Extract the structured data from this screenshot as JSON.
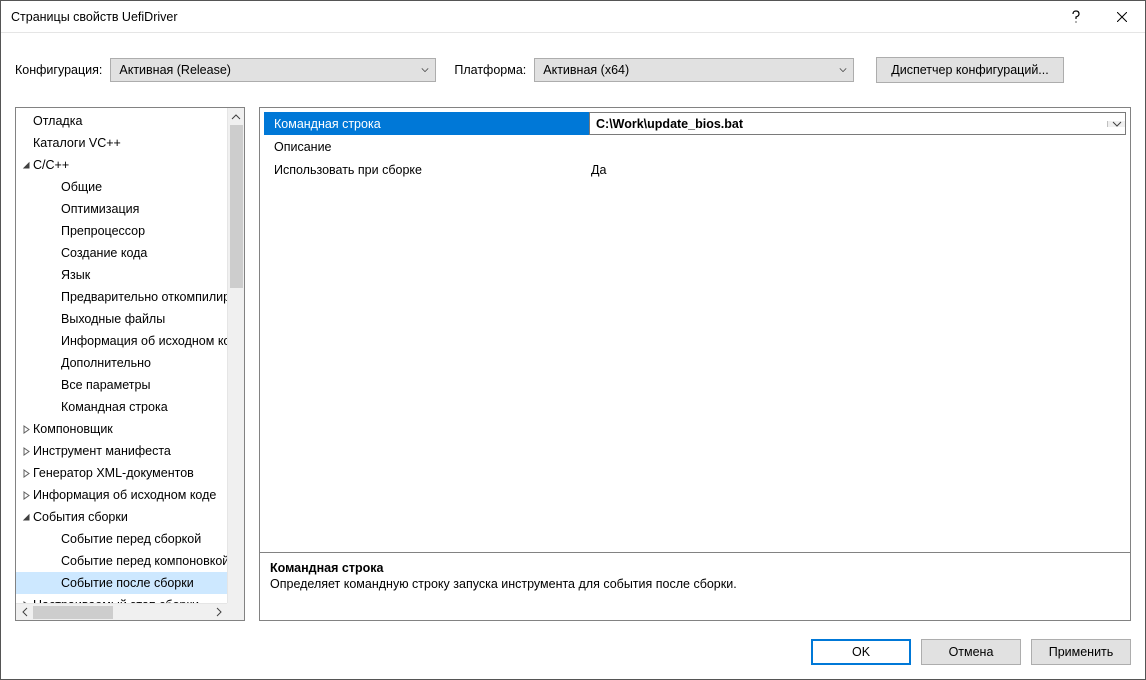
{
  "window": {
    "title": "Страницы свойств UefiDriver"
  },
  "config": {
    "label": "Конфигурация:",
    "value": "Активная (Release)"
  },
  "platform": {
    "label": "Платформа:",
    "value": "Активная (x64)"
  },
  "config_manager": "Диспетчер конфигураций...",
  "tree": {
    "items": [
      {
        "level": 1,
        "label": "Отладка",
        "expand": "none"
      },
      {
        "level": 1,
        "label": "Каталоги VC++",
        "expand": "none"
      },
      {
        "level": 1,
        "label": "C/C++",
        "expand": "open"
      },
      {
        "level": 2,
        "label": "Общие",
        "expand": "none"
      },
      {
        "level": 2,
        "label": "Оптимизация",
        "expand": "none"
      },
      {
        "level": 2,
        "label": "Препроцессор",
        "expand": "none"
      },
      {
        "level": 2,
        "label": "Создание кода",
        "expand": "none"
      },
      {
        "level": 2,
        "label": "Язык",
        "expand": "none"
      },
      {
        "level": 2,
        "label": "Предварительно откомпилированные заголовки",
        "expand": "none"
      },
      {
        "level": 2,
        "label": "Выходные файлы",
        "expand": "none"
      },
      {
        "level": 2,
        "label": "Информация об исходном коде",
        "expand": "none"
      },
      {
        "level": 2,
        "label": "Дополнительно",
        "expand": "none"
      },
      {
        "level": 2,
        "label": "Все параметры",
        "expand": "none"
      },
      {
        "level": 2,
        "label": "Командная строка",
        "expand": "none"
      },
      {
        "level": 1,
        "label": "Компоновщик",
        "expand": "closed"
      },
      {
        "level": 1,
        "label": "Инструмент манифеста",
        "expand": "closed"
      },
      {
        "level": 1,
        "label": "Генератор XML-документов",
        "expand": "closed"
      },
      {
        "level": 1,
        "label": "Информация об исходном коде",
        "expand": "closed"
      },
      {
        "level": 1,
        "label": "События сборки",
        "expand": "open"
      },
      {
        "level": 2,
        "label": "Событие перед сборкой",
        "expand": "none"
      },
      {
        "level": 2,
        "label": "Событие перед компоновкой",
        "expand": "none"
      },
      {
        "level": 2,
        "label": "Событие после сборки",
        "expand": "none",
        "selected": true
      },
      {
        "level": 1,
        "label": "Настраиваемый этап сборки",
        "expand": "closed"
      }
    ]
  },
  "grid": {
    "rows": [
      {
        "key": "Командная строка",
        "value": "C:\\Work\\update_bios.bat",
        "selected": true
      },
      {
        "key": "Описание",
        "value": ""
      },
      {
        "key": "Использовать при сборке",
        "value": "Да"
      }
    ]
  },
  "desc": {
    "title": "Командная строка",
    "text": "Определяет командную строку запуска инструмента для события после сборки."
  },
  "footer": {
    "ok": "OK",
    "cancel": "Отмена",
    "apply": "Применить"
  }
}
